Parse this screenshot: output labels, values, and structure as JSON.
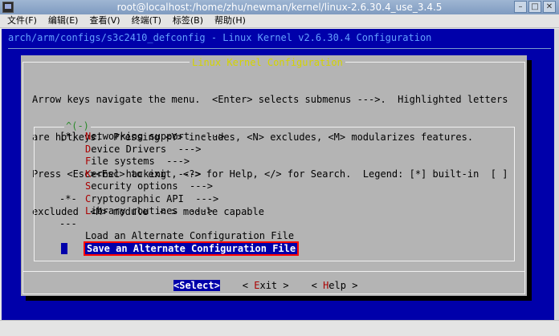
{
  "window": {
    "title": "root@localhost:/home/zhu/newman/kernel/linux-2.6.30.4_use_3.4.5",
    "buttons": [
      "–",
      "□",
      "✕"
    ]
  },
  "menubar": [
    "文件(F)",
    "编辑(E)",
    "查看(V)",
    "终端(T)",
    "标签(B)",
    "帮助(H)"
  ],
  "terminal": {
    "header": "arch/arm/configs/s3c2410_defconfig - Linux Kernel v2.6.30.4 Configuration",
    "dialog_title": "Linux Kernel Configuration",
    "help_lines": [
      "Arrow keys navigate the menu.  <Enter> selects submenus --->.  Highlighted letters",
      "are hotkeys.  Pressing <Y> includes, <N> excludes, <M> modularizes features.",
      "Press <Esc><Esc> to exit, <?> for Help, </> for Search.  Legend: [*] built-in  [ ]",
      "excluded  <M> module  < > module capable"
    ],
    "menu_box_label": "^(-)",
    "menu_items": [
      {
        "mark": "[*]",
        "hotkey": "N",
        "rest": "etworking support  --->"
      },
      {
        "mark": "",
        "hotkey": "D",
        "rest": "evice Drivers  --->"
      },
      {
        "mark": "",
        "hotkey": "F",
        "rest": "ile systems  --->"
      },
      {
        "mark": "",
        "hotkey": "K",
        "rest": "ernel hacking  --->"
      },
      {
        "mark": "",
        "hotkey": "S",
        "rest": "ecurity options  --->"
      },
      {
        "mark": "-*-",
        "hotkey": "C",
        "rest": "ryptographic API  --->"
      },
      {
        "mark": "",
        "hotkey": "L",
        "rest": "ibrary routines  --->"
      },
      {
        "mark": "---",
        "hotkey": "",
        "rest": ""
      },
      {
        "mark": "",
        "hotkey": "",
        "rest": "Load an Alternate Configuration File"
      },
      {
        "mark": "",
        "hotkey": "",
        "rest": "Save an Alternate Configuration File",
        "selected": true
      }
    ],
    "buttons": [
      {
        "label": "<Select>",
        "active": true
      },
      {
        "label": "< Exit >",
        "hotkey_char": "E"
      },
      {
        "label": "< Help >",
        "hotkey_char": "H"
      }
    ]
  },
  "colors": {
    "terminal_bg": "#0000aa",
    "dialog_bg": "#b4b4b4",
    "hotkey": "#aa0000",
    "dialog_title": "#d4d400",
    "selection_outline": "#ff0000"
  }
}
